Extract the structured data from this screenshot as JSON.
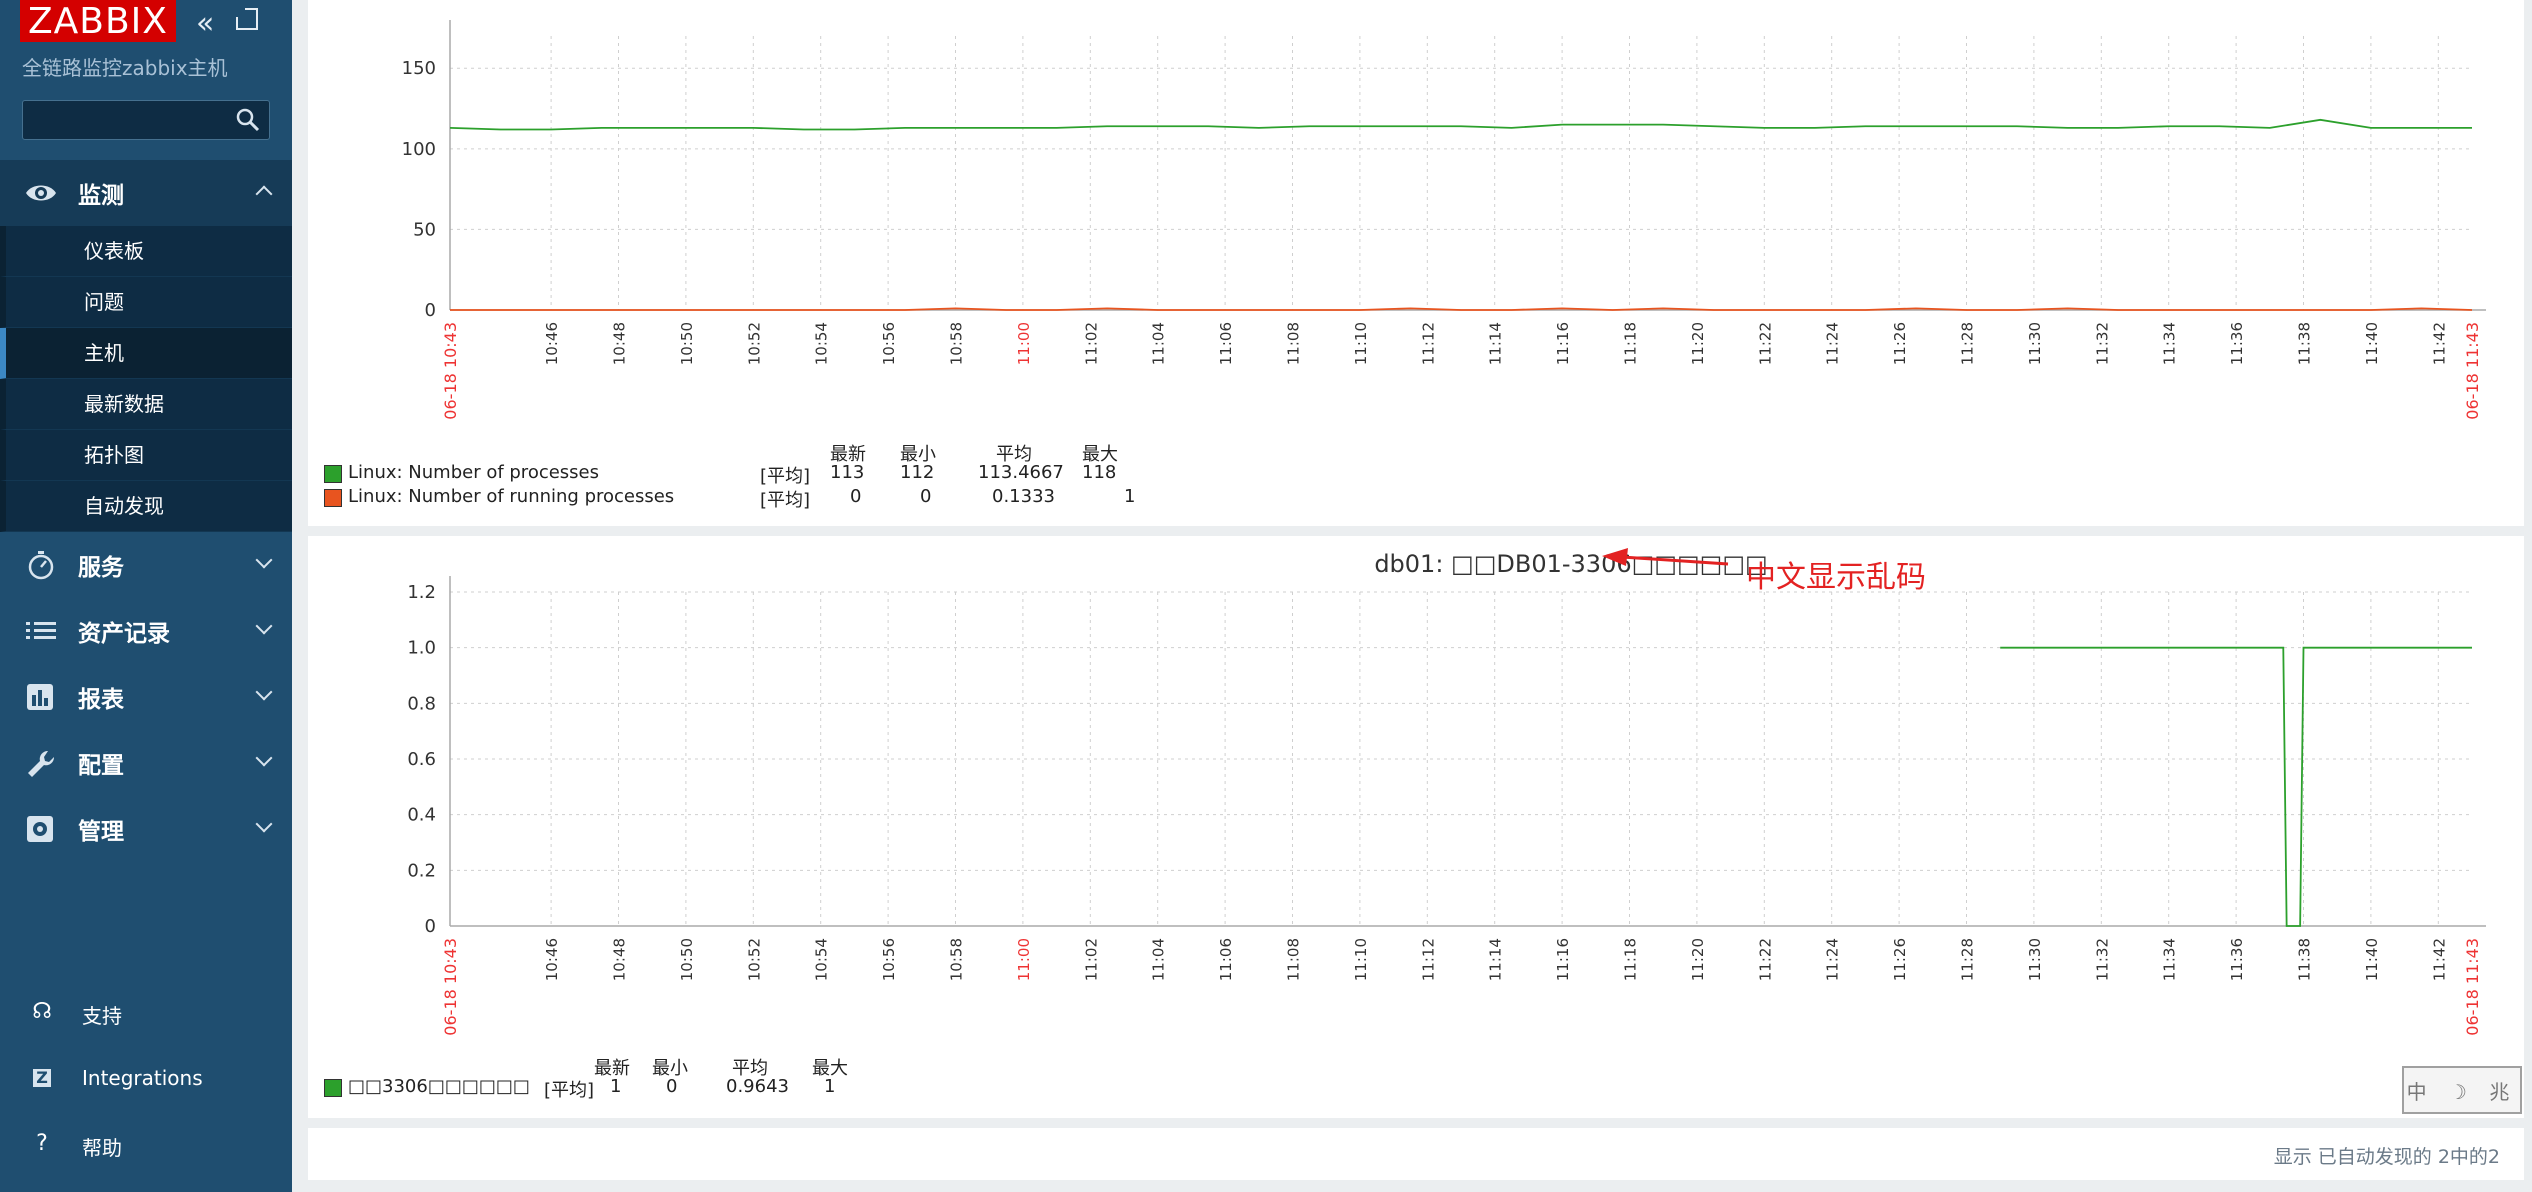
{
  "app": {
    "logo": "ZABBIX",
    "server_name": "全链路监控zabbix主机",
    "search_placeholder": ""
  },
  "menu": [
    {
      "label": "监测",
      "icon": "eye-icon",
      "expanded": true,
      "children": [
        "仪表板",
        "问题",
        "主机",
        "最新数据",
        "拓扑图",
        "自动发现"
      ],
      "selected": "主机"
    },
    {
      "label": "服务",
      "icon": "stopwatch-icon"
    },
    {
      "label": "资产记录",
      "icon": "list-icon"
    },
    {
      "label": "报表",
      "icon": "bar-chart-icon"
    },
    {
      "label": "配置",
      "icon": "wrench-icon"
    },
    {
      "label": "管理",
      "icon": "gear-icon"
    }
  ],
  "bottom_menu": [
    {
      "label": "支持",
      "icon": "headset-icon"
    },
    {
      "label": "Integrations",
      "icon": "zabbix-z-icon"
    },
    {
      "label": "帮助",
      "icon": "question-icon"
    }
  ],
  "chart_data": [
    {
      "type": "line",
      "title": "",
      "x": [
        "10:46",
        "10:48",
        "10:50",
        "10:52",
        "10:54",
        "10:56",
        "10:58",
        "11:00",
        "11:02",
        "11:04",
        "11:06",
        "11:08",
        "11:10",
        "11:12",
        "11:14",
        "11:16",
        "11:18",
        "11:20",
        "11:22",
        "11:24",
        "11:26",
        "11:28",
        "11:30",
        "11:32",
        "11:34",
        "11:36",
        "11:38",
        "11:40",
        "11:42"
      ],
      "x_start_label": "06-18 10:43",
      "x_end_label": "06-18 11:43",
      "yticks": [
        "0",
        "50",
        "100",
        "150"
      ],
      "ylim": [
        0,
        170
      ],
      "grid": true,
      "series": [
        {
          "name": "Linux: Number of processes",
          "color": "#2ca02c",
          "values": [
            113,
            112,
            112,
            113,
            113,
            113,
            113,
            112,
            112,
            113,
            113,
            113,
            113,
            114,
            114,
            114,
            113,
            114,
            114,
            114,
            114,
            113,
            115,
            115,
            115,
            114,
            113,
            113,
            114,
            114,
            114,
            114,
            113,
            113,
            114,
            114,
            113,
            118,
            113,
            113,
            113
          ]
        },
        {
          "name": "Linux: Number of running processes",
          "color": "#e8541f",
          "values": [
            0,
            0,
            0,
            0,
            0,
            0,
            0,
            0,
            0,
            0,
            1,
            0,
            0,
            1,
            0,
            0,
            0,
            0,
            0,
            1,
            0,
            0,
            1,
            0,
            1,
            0,
            0,
            0,
            0,
            1,
            0,
            0,
            1,
            0,
            0,
            0,
            0,
            0,
            0,
            1,
            0
          ]
        }
      ],
      "legend": {
        "header": [
          "最新",
          "最小",
          "平均",
          "最大"
        ],
        "rows": [
          {
            "name": "Linux: Number of processes",
            "unit": "[平均]",
            "last": "113",
            "min": "112",
            "avg": "113.4667",
            "max": "118",
            "color": "#2ca02c"
          },
          {
            "name": "Linux: Number of running processes",
            "unit": "[平均]",
            "last": "0",
            "min": "0",
            "avg": "0.1333",
            "max": "1",
            "color": "#e8541f"
          }
        ]
      }
    },
    {
      "type": "line",
      "title": "db01: □□DB01-3306□□□□□□",
      "x": [
        "10:46",
        "10:48",
        "10:50",
        "10:52",
        "10:54",
        "10:56",
        "10:58",
        "11:00",
        "11:02",
        "11:04",
        "11:06",
        "11:08",
        "11:10",
        "11:12",
        "11:14",
        "11:16",
        "11:18",
        "11:20",
        "11:22",
        "11:24",
        "11:26",
        "11:28",
        "11:30",
        "11:32",
        "11:34",
        "11:36",
        "11:38",
        "11:40",
        "11:42"
      ],
      "x_start_label": "06-18 10:43",
      "x_end_label": "06-18 11:43",
      "yticks": [
        "0",
        "0.2",
        "0.4",
        "0.6",
        "0.8",
        "1.0",
        "1.2"
      ],
      "ylim": [
        0,
        1.2
      ],
      "grid": true,
      "series": [
        {
          "name": "□□3306□□□□□□",
          "color": "#2ca02c",
          "points": [
            [
              46.0,
              1
            ],
            [
              54.4,
              1
            ],
            [
              54.5,
              0
            ],
            [
              54.9,
              0
            ],
            [
              55.0,
              1
            ],
            [
              60,
              1
            ]
          ]
        }
      ],
      "legend": {
        "header": [
          "最新",
          "最小",
          "平均",
          "最大"
        ],
        "rows": [
          {
            "name": "□□3306□□□□□□",
            "unit": "[平均]",
            "last": "1",
            "min": "0",
            "avg": "0.9643",
            "max": "1",
            "color": "#2ca02c"
          }
        ]
      }
    }
  ],
  "annotation": "中文显示乱码",
  "ime_indicator": "中 ☽ 兆",
  "footer": {
    "text": "显示 已自动发现的 2中的2"
  }
}
